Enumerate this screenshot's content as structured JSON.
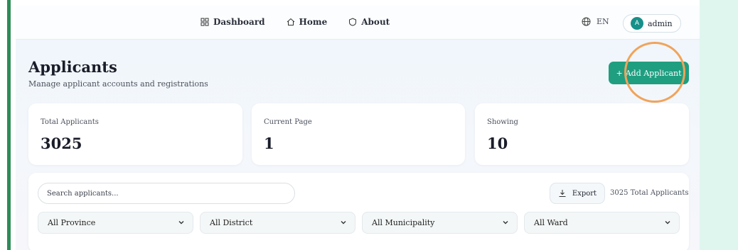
{
  "nav": {
    "links": [
      {
        "label": "Dashboard",
        "icon": "grid-icon"
      },
      {
        "label": "Home",
        "icon": "home-icon"
      },
      {
        "label": "About",
        "icon": "info-icon"
      }
    ],
    "language": "EN",
    "user": {
      "initial": "A",
      "name": "admin"
    }
  },
  "header": {
    "title": "Applicants",
    "subtitle": "Manage applicant accounts and registrations",
    "add_button": "Add Applicant"
  },
  "stats": [
    {
      "label": "Total Applicants",
      "value": "3025"
    },
    {
      "label": "Current Page",
      "value": "1"
    },
    {
      "label": "Showing",
      "value": "10"
    }
  ],
  "toolbar": {
    "search_placeholder": "Search applicants...",
    "search_value": "",
    "export_label": "Export",
    "total_note": "3025 Total Applicants"
  },
  "filters": [
    {
      "selected": "All Province"
    },
    {
      "selected": "All District"
    },
    {
      "selected": "All Municipality"
    },
    {
      "selected": "All Ward"
    }
  ],
  "colors": {
    "accent": "#1f9e80",
    "sidebar_bar": "#2e8b57",
    "focus_ring": "#f1a35a",
    "avatar": "#17908a"
  }
}
